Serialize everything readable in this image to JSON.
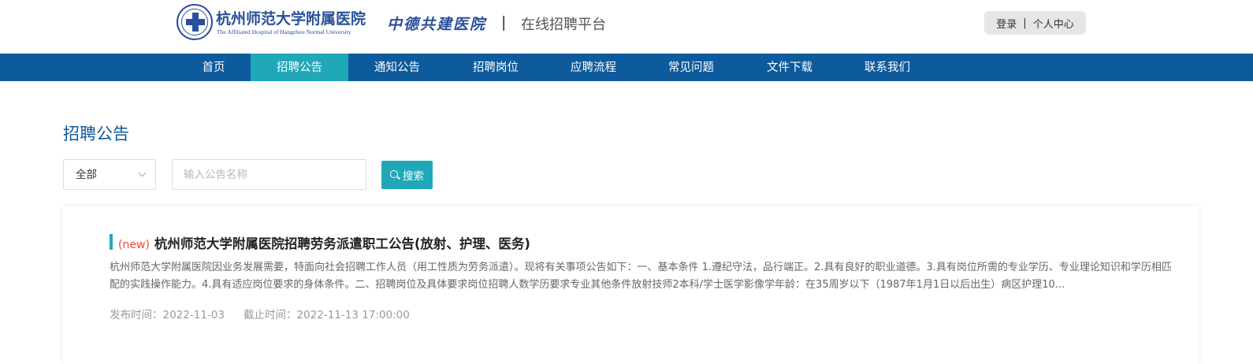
{
  "header": {
    "logo_cn": "杭州师范大学附属医院",
    "logo_en": "The Affiliated Hospital of Hangzhou Normal University",
    "partner": "中德共建医院",
    "separator": "|",
    "platform": "在线招聘平台",
    "login": "登录",
    "user_sep": "|",
    "user_center": "个人中心"
  },
  "nav": {
    "items": [
      {
        "label": "首页"
      },
      {
        "label": "招聘公告",
        "active": true
      },
      {
        "label": "通知公告"
      },
      {
        "label": "招聘岗位"
      },
      {
        "label": "应聘流程"
      },
      {
        "label": "常见问题"
      },
      {
        "label": "文件下载"
      },
      {
        "label": "联系我们"
      }
    ]
  },
  "page": {
    "title": "招聘公告"
  },
  "filter": {
    "select_value": "全部",
    "search_placeholder": "输入公告名称",
    "search_button": "搜索"
  },
  "notices": [
    {
      "badge": "(new)",
      "title": "杭州师范大学附属医院招聘劳务派遣职工公告(放射、护理、医务)",
      "summary": "杭州师范大学附属医院因业务发展需要，特面向社会招聘工作人员（用工性质为劳务派遣）。现将有关事项公告如下：一、基本条件 1.遵纪守法，品行端正。2.具有良好的职业道德。3.具有岗位所需的专业学历、专业理论知识和学历相匹配的实践操作能力。4.具有适应岗位要求的身体条件。二、招聘岗位及具体要求岗位招聘人数学历要求专业其他条件放射技师2本科/学士医学影像学年龄：在35周岁以下（1987年1月1日以后出生）病区护理10...",
      "publish_label": "发布时间：",
      "publish_date": "2022-11-03",
      "deadline_label": "截止时间：",
      "deadline": "2022-11-13 17:00:00"
    }
  ],
  "colors": {
    "nav_bg": "#0d5a9c",
    "accent": "#20a8b9",
    "brand_blue": "#2a4f9a",
    "new_badge": "#e84a3a"
  }
}
